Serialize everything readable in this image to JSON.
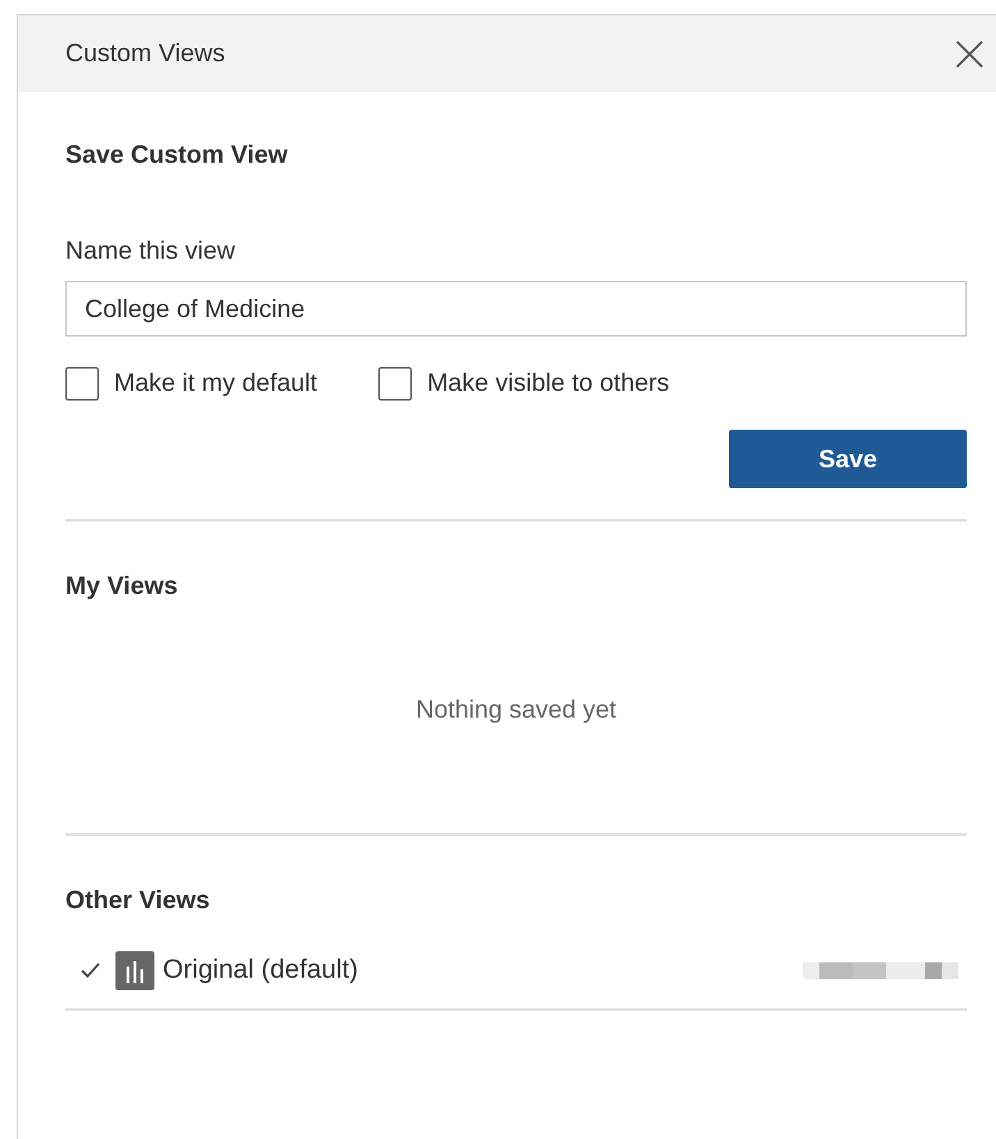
{
  "window": {
    "title": "Custom Views"
  },
  "save_section": {
    "heading": "Save Custom View",
    "name_label": "Name this view",
    "name_value": "College of Medicine",
    "options": [
      {
        "label": "Make it my default",
        "checked": false
      },
      {
        "label": "Make visible to others",
        "checked": false
      }
    ],
    "button": "Save"
  },
  "my_views": {
    "heading": "My Views",
    "empty_message": "Nothing saved yet"
  },
  "other_views": {
    "heading": "Other Views",
    "items": [
      {
        "label": "Original (default)",
        "selected": true
      }
    ]
  }
}
